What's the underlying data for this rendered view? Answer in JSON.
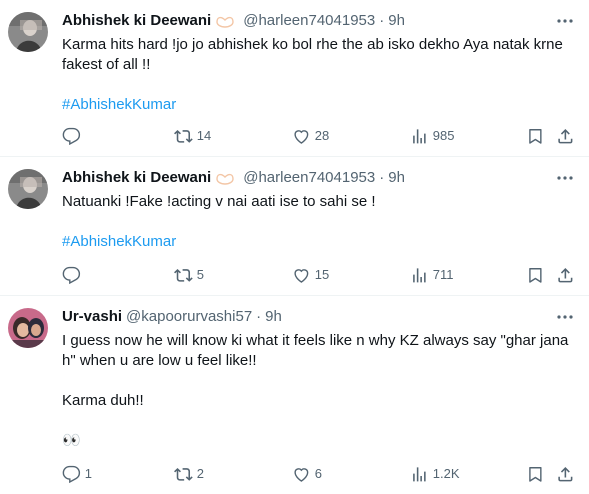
{
  "colors": {
    "text_primary": "#0f1419",
    "text_secondary": "#536471",
    "link": "#1d9bf0",
    "divider": "#eff3f4"
  },
  "tweets": [
    {
      "name": "Abhishek ki Deewani",
      "has_heart_emoji": true,
      "handle": "@harleen74041953",
      "dot": "·",
      "time": "9h",
      "text": "Karma hits hard !jo jo abhishek ko bol rhe the ab isko dekho Aya natak krne fakest of all !!",
      "hashtag": "#AbhishekKumar",
      "replies": "",
      "retweets": "14",
      "likes": "28",
      "views": "985"
    },
    {
      "name": "Abhishek ki Deewani",
      "has_heart_emoji": true,
      "handle": "@harleen74041953",
      "dot": "·",
      "time": "9h",
      "text": "Natuanki !Fake !acting v nai aati ise to sahi se !",
      "hashtag": "#AbhishekKumar",
      "replies": "",
      "retweets": "5",
      "likes": "15",
      "views": "711"
    },
    {
      "name": "Ur-vashi",
      "has_heart_emoji": false,
      "handle": "@kapoorurvashi57",
      "dot": "·",
      "time": "9h",
      "text": "I guess now he will know ki what it feels like n why KZ always say \"ghar jana h\" when u are low u feel like!!\n\nKarma duh!!\n\n👀",
      "hashtag": "",
      "replies": "1",
      "retweets": "2",
      "likes": "6",
      "views": "1.2K"
    }
  ],
  "icons": {
    "reply": "reply-icon",
    "retweet": "retweet-icon",
    "like": "heart-icon",
    "views": "views-icon",
    "bookmark": "bookmark-icon",
    "share": "share-icon",
    "more": "more-icon"
  }
}
